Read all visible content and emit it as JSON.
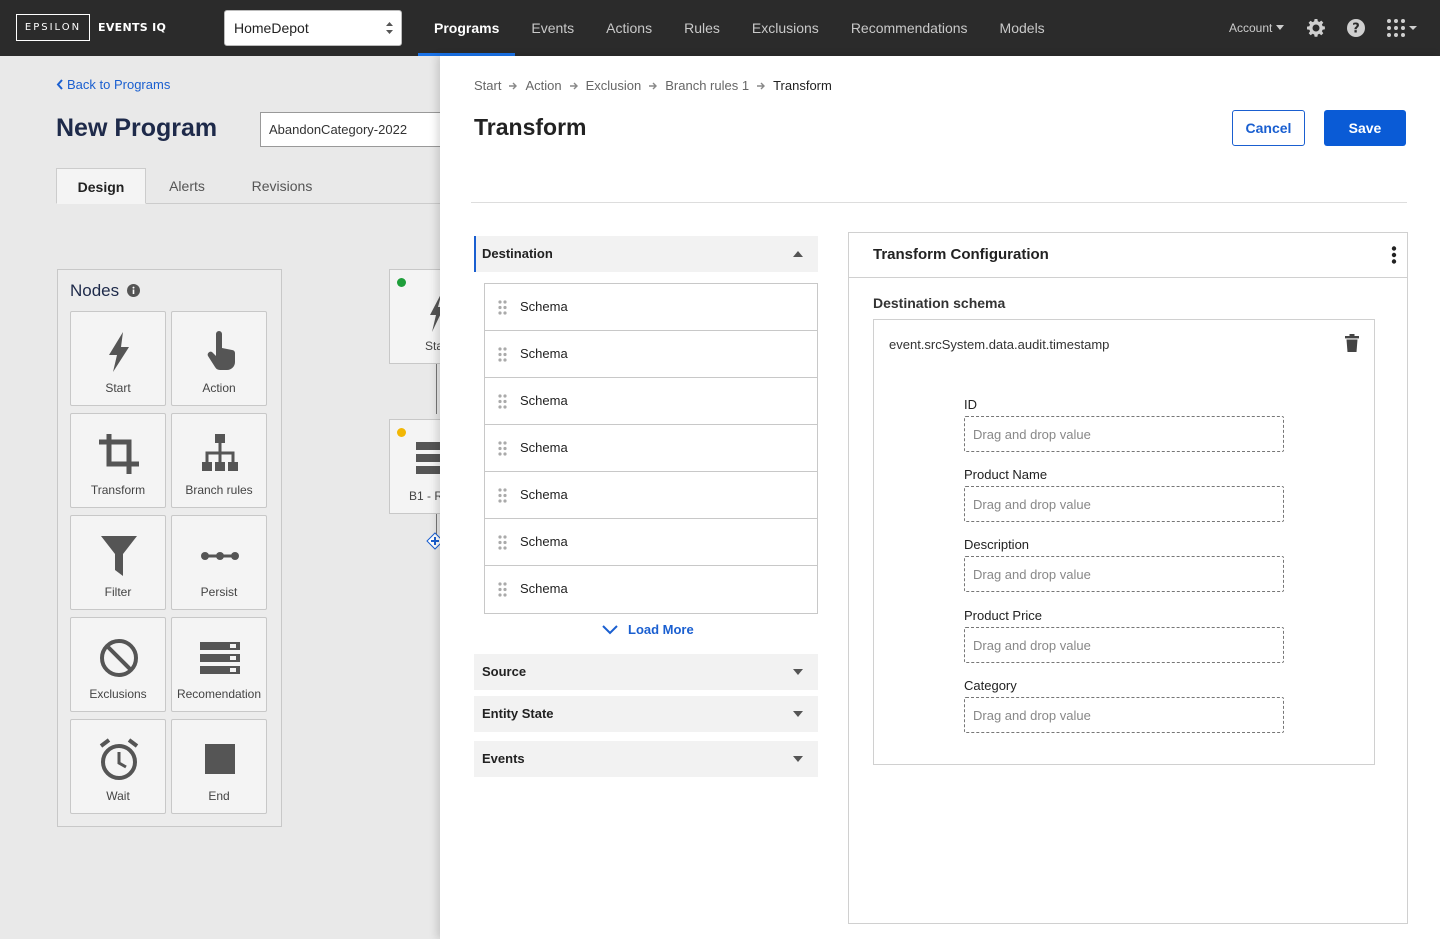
{
  "brand": {
    "logo": "EPSILON",
    "app": "EVENTS IQ"
  },
  "client_select": {
    "value": "HomeDepot"
  },
  "nav": {
    "items": [
      "Programs",
      "Events",
      "Actions",
      "Rules",
      "Exclusions",
      "Recommendations",
      "Models"
    ],
    "active": "Programs"
  },
  "account": {
    "label": "Account"
  },
  "top_icons": [
    "gear-icon",
    "help-icon",
    "apps-grid-icon"
  ],
  "background_page": {
    "back_link": "Back to Programs",
    "title": "New Program",
    "program_name": "AbandonCategory-2022",
    "tabs": [
      "Design",
      "Alerts",
      "Revisions"
    ],
    "nodes": {
      "title": "Nodes",
      "items": [
        "Start",
        "Action",
        "Transform",
        "Branch rules",
        "Filter",
        "Persist",
        "Exclusions",
        "Recomendation",
        "Wait",
        "End"
      ]
    },
    "canvas": {
      "card1_label": "Sta",
      "card2_label": "B1 - R"
    }
  },
  "drawer": {
    "breadcrumb": [
      "Start",
      "Action",
      "Exclusion",
      "Branch rules 1",
      "Transform"
    ],
    "title": "Transform",
    "cancel_label": "Cancel",
    "save_label": "Save",
    "accordion": {
      "destination": {
        "label": "Destination",
        "items": [
          "Schema",
          "Schema",
          "Schema",
          "Schema",
          "Schema",
          "Schema",
          "Schema"
        ],
        "load_more": "Load More"
      },
      "source": "Source",
      "entity_state": "Entity State",
      "events": "Events"
    },
    "config": {
      "title": "Transform Configuration",
      "destination_label": "Destination schema",
      "schema_path": "event.srcSystem.data.audit.timestamp",
      "fields": [
        {
          "label": "ID",
          "placeholder": "Drag and drop value"
        },
        {
          "label": "Product Name",
          "placeholder": "Drag and drop value"
        },
        {
          "label": "Description",
          "placeholder": "Drag and drop value"
        },
        {
          "label": "Product Price",
          "placeholder": "Drag and drop value"
        },
        {
          "label": "Category",
          "placeholder": "Drag and drop value"
        }
      ]
    }
  },
  "colors": {
    "accent": "#0a5bd6",
    "topbar": "#2b2b2b",
    "status_green": "#1e9e3a",
    "status_yellow": "#f2b705"
  }
}
